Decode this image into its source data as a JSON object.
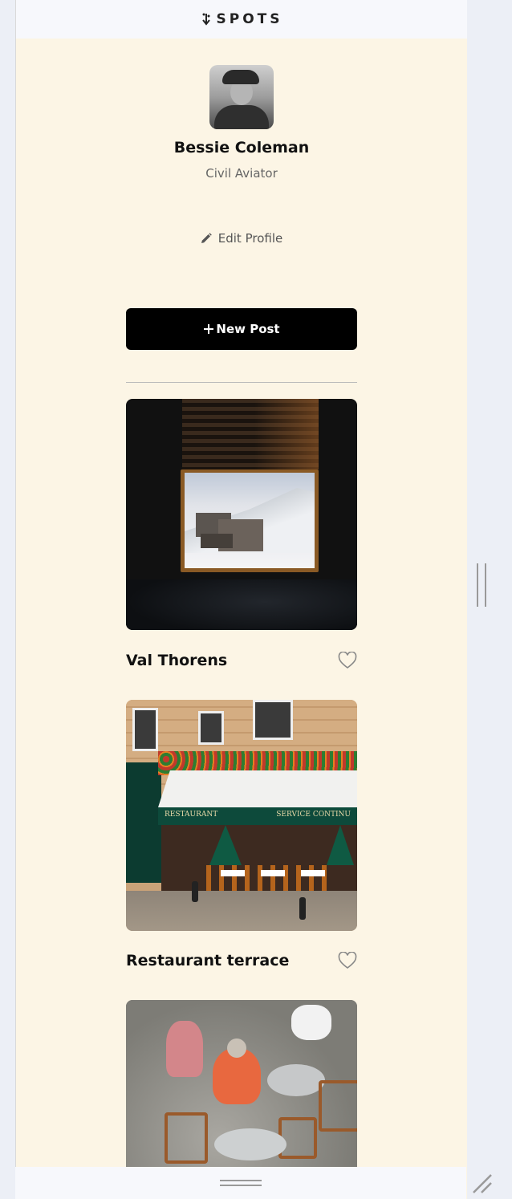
{
  "header": {
    "logo_text": "SPOTS",
    "logo_icon": "vine-arrow-icon"
  },
  "profile": {
    "name": "Bessie Coleman",
    "subtitle": "Civil Aviator",
    "edit_label": "Edit Profile"
  },
  "actions": {
    "new_post_label": "New Post"
  },
  "cards": [
    {
      "title": "Val Thorens",
      "liked": false
    },
    {
      "title": "Restaurant terrace",
      "liked": false
    },
    {
      "title": "",
      "liked": false
    }
  ],
  "colors": {
    "background": "#fcf5e5",
    "button": "#000000",
    "topbar": "#f7f8fc"
  }
}
